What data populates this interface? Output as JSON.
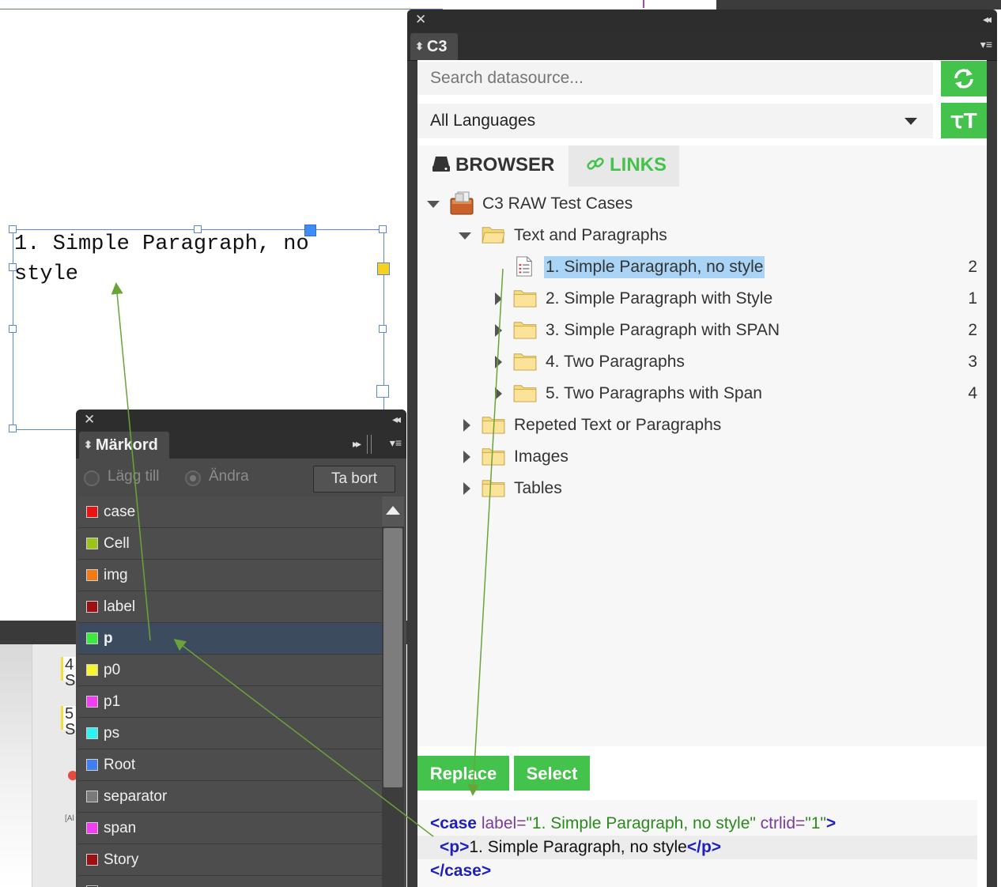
{
  "document": {
    "frame_text_line1": "1. Simple Paragraph, no",
    "frame_text_line2": "style",
    "bottom_lines": [
      {
        "num": "4",
        "sub": "S"
      },
      {
        "num": "5",
        "sub": "S"
      }
    ],
    "bottom_label": "[Al"
  },
  "c3_panel": {
    "close_glyph": "✕",
    "collapse_glyph": "◂◂",
    "tab_label": "C3",
    "menu_glyph": "▾≡",
    "search": {
      "placeholder": "Search datasource...",
      "value": ""
    },
    "refresh_icon": "refresh-icon",
    "language_select": {
      "value": "All Languages"
    },
    "font_button_glyph": "ꚍT",
    "tabs": {
      "browser": "BROWSER",
      "links": "LINKS"
    },
    "tree": [
      {
        "label": "C3 RAW Test Cases",
        "level": 0,
        "expanded": true,
        "icon": "package-icon",
        "count": ""
      },
      {
        "label": "Text and Paragraphs",
        "level": 1,
        "expanded": true,
        "icon": "folder-open-icon",
        "count": ""
      },
      {
        "label": "1. Simple Paragraph, no style",
        "level": 2,
        "expanded": null,
        "icon": "document-icon",
        "count": "2",
        "selected": true
      },
      {
        "label": "2. Simple Paragraph with Style",
        "level": 2,
        "expanded": false,
        "icon": "folder-icon",
        "count": "1"
      },
      {
        "label": "3. Simple Paragraph with SPAN",
        "level": 2,
        "expanded": false,
        "icon": "folder-icon",
        "count": "2"
      },
      {
        "label": "4. Two Paragraphs",
        "level": 2,
        "expanded": false,
        "icon": "folder-icon",
        "count": "3"
      },
      {
        "label": "5. Two Paragraphs with Span",
        "level": 2,
        "expanded": false,
        "icon": "folder-icon",
        "count": "4"
      },
      {
        "label": "Repeted Text or Paragraphs",
        "level": 1,
        "expanded": false,
        "icon": "folder-icon",
        "count": ""
      },
      {
        "label": "Images",
        "level": 1,
        "expanded": false,
        "icon": "folder-icon",
        "count": ""
      },
      {
        "label": "Tables",
        "level": 1,
        "expanded": false,
        "icon": "folder-icon",
        "count": ""
      }
    ],
    "buttons": {
      "replace": "Replace",
      "select": "Select"
    },
    "code": {
      "l1_open": "<case",
      "l1_attr1": " label=",
      "l1_val1": "\"1. Simple Paragraph, no style\"",
      "l1_attr2": " ctrlid=",
      "l1_val2": "\"1\"",
      "l1_close": ">",
      "l2_open": "<p>",
      "l2_text": "1. Simple Paragraph, no style",
      "l2_close": "</p>",
      "l3": "</case>"
    }
  },
  "markord_panel": {
    "close_glyph": "✕",
    "collapse_glyph": "◂◂",
    "tab_label": "Märkord",
    "forward_glyph": "▸▸",
    "menu_glyph": "▾≡",
    "radio_add": "Lägg till",
    "radio_change": "Ändra",
    "delete_button": "Ta bort",
    "tags": [
      {
        "name": "case",
        "color": "#e81414"
      },
      {
        "name": "Cell",
        "color": "#9bc31c"
      },
      {
        "name": "img",
        "color": "#f07a14"
      },
      {
        "name": "label",
        "color": "#9b1010"
      },
      {
        "name": "p",
        "color": "#3ee83e",
        "selected": true
      },
      {
        "name": "p0",
        "color": "#f5f533"
      },
      {
        "name": "p1",
        "color": "#f03ef0"
      },
      {
        "name": "ps",
        "color": "#30f0f0"
      },
      {
        "name": "Root",
        "color": "#3f7ff0"
      },
      {
        "name": "separator",
        "color": "#7a7a7a"
      },
      {
        "name": "span",
        "color": "#f03ef0"
      },
      {
        "name": "Story",
        "color": "#9b1010"
      },
      {
        "name": "",
        "color": "#222222"
      }
    ]
  },
  "colors": {
    "accent_green": "#43c34c",
    "selection_blue": "#a9d4f5",
    "arrow_green": "#6aa33a"
  }
}
